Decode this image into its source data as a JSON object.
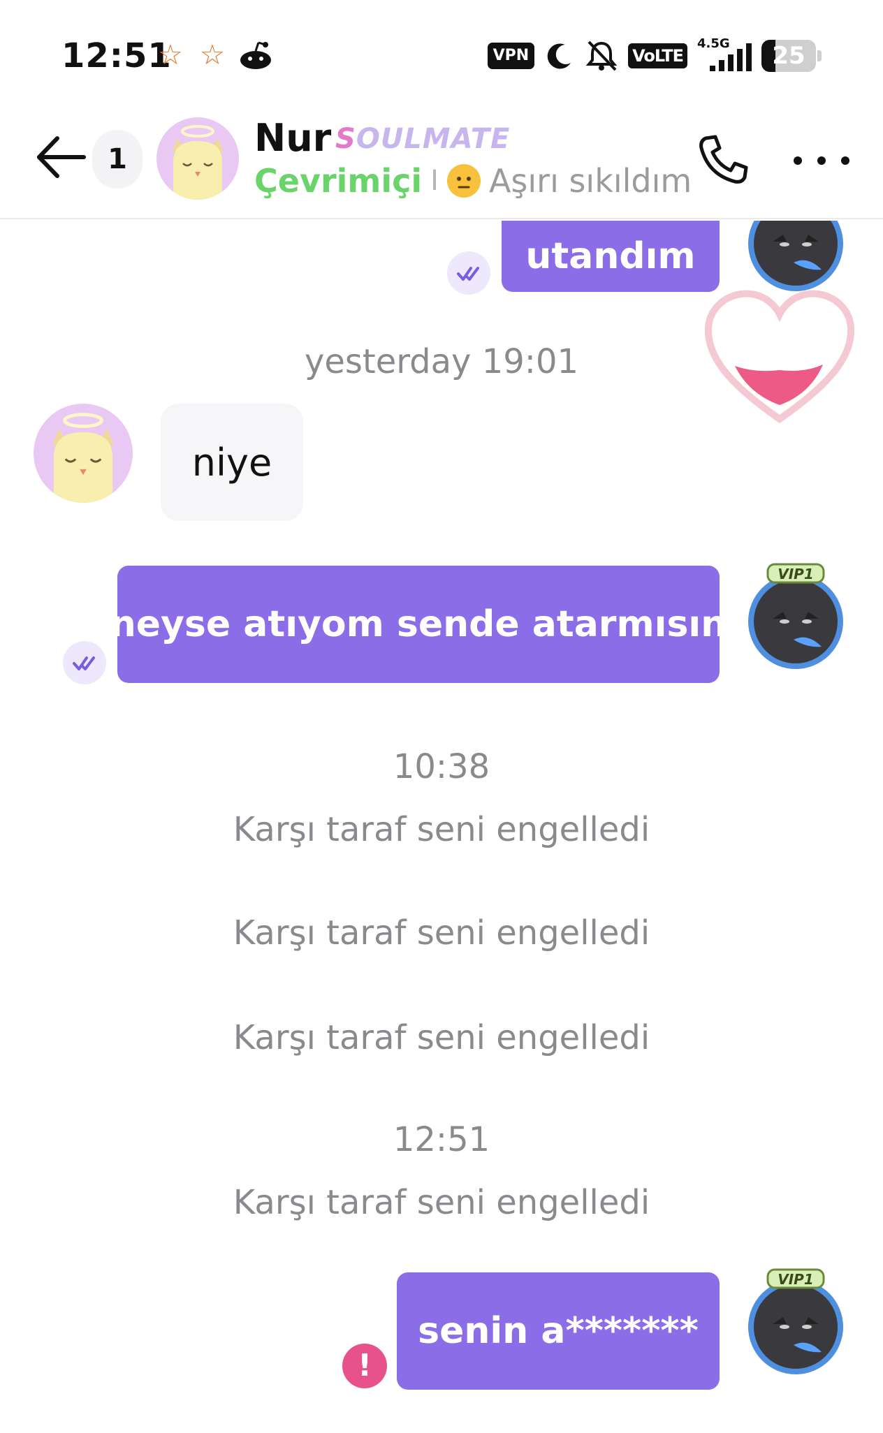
{
  "status_bar": {
    "time": "12:51",
    "vpn_label": "VPN",
    "volte_label": "VoLTE",
    "network_label": "4.5G",
    "battery_level": "25",
    "icons": [
      "star-icon",
      "star-icon",
      "reddit-icon",
      "vpn-icon",
      "moon-icon",
      "bell-off-icon",
      "volte-icon",
      "signal-icon",
      "battery-icon"
    ]
  },
  "header": {
    "unread_count": "1",
    "contact_name": "Nur",
    "contact_tag": "SOULMATE",
    "online_status": "Çevrimiçi",
    "separator": "I",
    "mood_text": "Aşırı sıkıldım",
    "icons": [
      "back-arrow-icon",
      "phone-icon",
      "more-icon"
    ]
  },
  "messages": [
    {
      "id": "m1",
      "from": "me",
      "text": "utandım",
      "status": "read"
    },
    {
      "id": "t1",
      "type": "timestamp",
      "text": "yesterday 19:01"
    },
    {
      "id": "m2",
      "from": "them",
      "text": "niye"
    },
    {
      "id": "m3",
      "from": "me",
      "text": "neyse atıyom sende atarmısın",
      "status": "read"
    },
    {
      "id": "t2",
      "type": "timestamp",
      "text": "10:38"
    },
    {
      "id": "s1",
      "type": "system",
      "text": "Karşı taraf seni engelledi"
    },
    {
      "id": "s2",
      "type": "system",
      "text": "Karşı taraf seni engelledi"
    },
    {
      "id": "s3",
      "type": "system",
      "text": "Karşı taraf seni engelledi"
    },
    {
      "id": "t3",
      "type": "timestamp",
      "text": "12:51"
    },
    {
      "id": "s4",
      "type": "system",
      "text": "Karşı taraf seni engelledi"
    },
    {
      "id": "m4",
      "from": "me",
      "text": "senin a*******",
      "status": "failed",
      "error_mark": "!"
    }
  ],
  "vip_badge": "VIP1",
  "colors": {
    "my_bubble": "#8c6de8",
    "their_bubble": "#f6f6f8",
    "online": "#6ad36a",
    "error": "#e8528a",
    "muted_text": "#8a8a8e"
  }
}
